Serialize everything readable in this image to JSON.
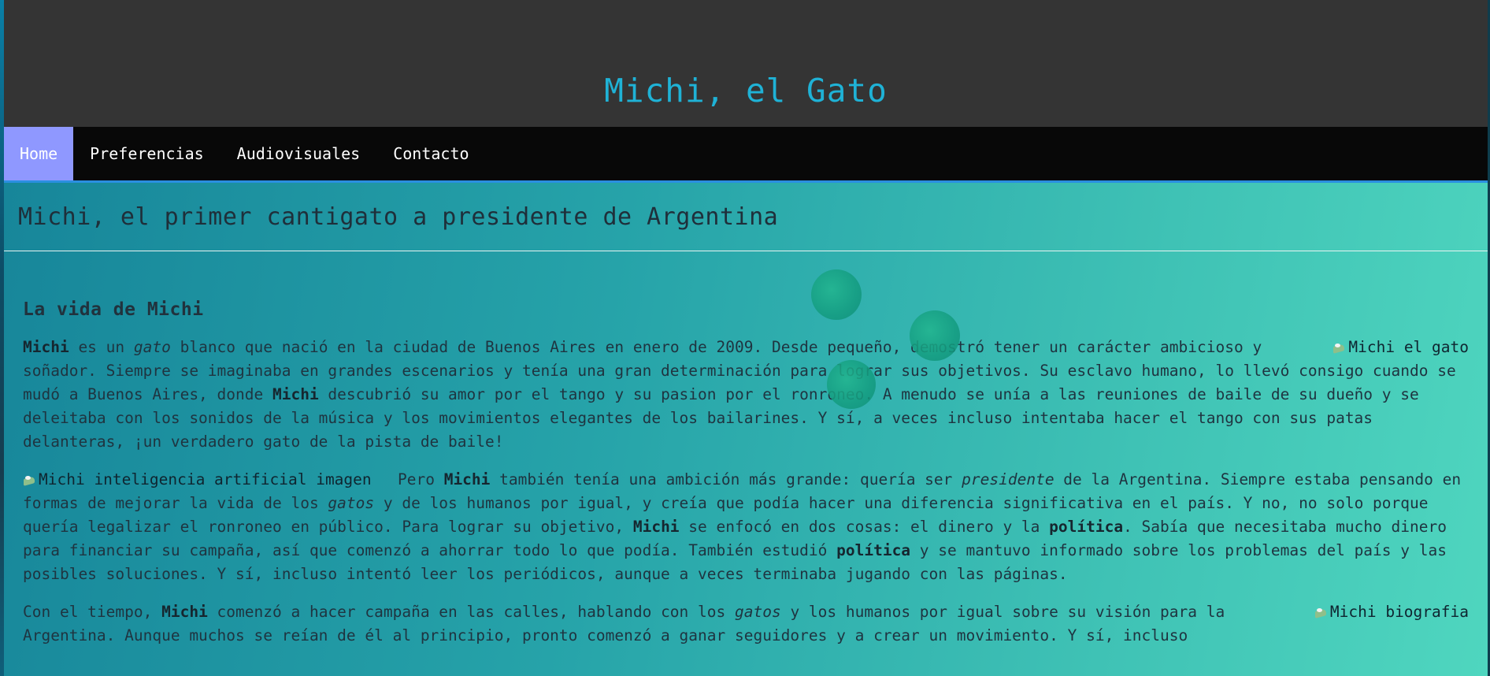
{
  "site": {
    "title": "Michi, el Gato"
  },
  "nav": {
    "items": [
      {
        "label": "Home",
        "active": true
      },
      {
        "label": "Preferencias",
        "active": false
      },
      {
        "label": "Audiovisuales",
        "active": false
      },
      {
        "label": "Contacto",
        "active": false
      }
    ]
  },
  "main": {
    "headline": "Michi, el primer cantigato a presidente de Argentina",
    "section_title": "La vida de Michi",
    "images": {
      "right_1_alt": "Michi el gato",
      "left_1_alt": "Michi inteligencia artificial imagen",
      "right_2_alt": "Michi biografia"
    },
    "p1": {
      "s1": "Michi",
      "s2": " es un ",
      "s3": "gato",
      "s4": " blanco que nació en la ciudad de Buenos Aires en enero de 2009. Desde pequeño, demostró tener un carácter ambicioso y soñador. Siempre se imaginaba en grandes escenarios y tenía una gran determinación para lograr sus objetivos. Su esclavo humano, lo llevó consigo cuando se mudó a Buenos Aires, donde ",
      "s5": "Michi",
      "s6": " descubrió su amor por el tango y su pasion por el ronroneo. A menudo se unía a las reuniones de baile de su dueño y se deleitaba con los sonidos de la música y los movimientos elegantes de los bailarines. Y sí, a veces incluso intentaba hacer el tango con sus patas delanteras, ¡un verdadero gato de la pista de baile!"
    },
    "p2": {
      "s1": "Pero ",
      "s2": "Michi",
      "s3": " también tenía una ambición más grande: quería ser ",
      "s4": "presidente",
      "s5": " de la Argentina. Siempre estaba pensando en formas de mejorar la vida de los ",
      "s6": "gatos",
      "s7": " y de los humanos por igual, y creía que podía hacer una diferencia significativa en el país. Y no, no solo porque quería legalizar el ronroneo en público. Para lograr su objetivo, ",
      "s8": "Michi",
      "s9": " se enfocó en dos cosas: el dinero y la ",
      "s10": "política",
      "s11": ". Sabía que necesitaba mucho dinero para financiar su campaña, así que comenzó a ahorrar todo lo que podía. También estudió ",
      "s12": "política",
      "s13": " y se mantuvo informado sobre los problemas del país y las posibles soluciones. Y sí, incluso intentó leer los periódicos, aunque a veces terminaba jugando con las páginas."
    },
    "p3": {
      "s1": "Con el tiempo, ",
      "s2": "Michi",
      "s3": " comenzó a hacer campaña en las calles, hablando con los ",
      "s4": "gatos",
      "s5": " y los humanos por igual sobre su visión para la Argentina. Aunque muchos se reían de él al principio, pronto comenzó a ganar seguidores y a crear un movimiento. Y sí, incluso"
    }
  },
  "colors": {
    "header_bg": "#343434",
    "title": "#1fb2d6",
    "nav_bg": "#080808",
    "nav_active": "#8f98ff",
    "nav_border": "#2a8fe0",
    "content_gradient_start": "#17869a",
    "content_gradient_end": "#4fd6bf"
  }
}
